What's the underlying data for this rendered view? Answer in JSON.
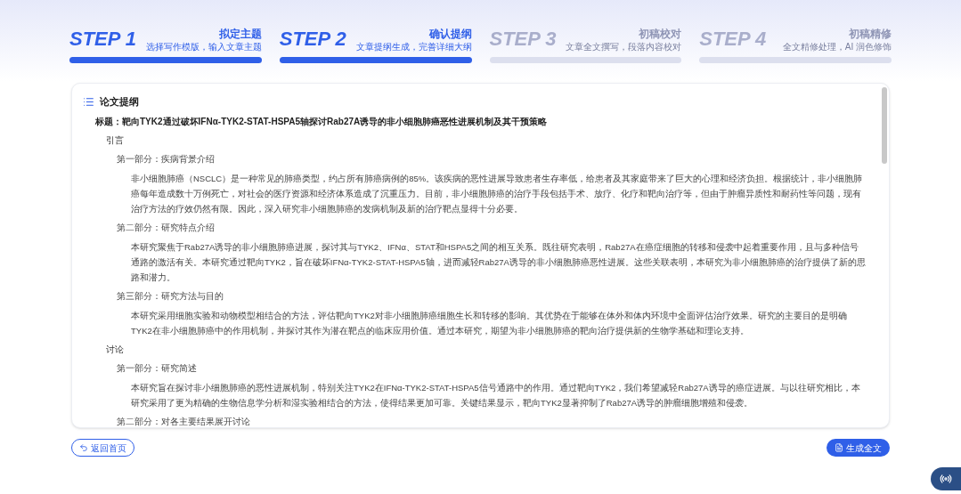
{
  "steps": [
    {
      "label": "STEP 1",
      "title": "拟定主题",
      "subtitle": "选择写作模版，输入文章主题",
      "active": true
    },
    {
      "label": "STEP 2",
      "title": "确认提纲",
      "subtitle": "文章提纲生成，完善详细大纲",
      "active": true
    },
    {
      "label": "STEP 3",
      "title": "初稿校对",
      "subtitle": "文章全文撰写，段落内容校对",
      "active": false
    },
    {
      "label": "STEP 4",
      "title": "初稿精修",
      "subtitle": "全文精修处理，AI 润色修饰",
      "active": false
    }
  ],
  "outline": {
    "heading": "论文提纲",
    "title": "标题：靶向TYK2通过破坏IFNα-TYK2-STAT-HSPA5轴探讨Rab27A诱导的非小细胞肺癌恶性进展机制及其干预策略",
    "sections": [
      {
        "name": "引言",
        "children": [
          {
            "name": "第一部分：疾病背景介绍",
            "text": "非小细胞肺癌（NSCLC）是一种常见的肺癌类型，约占所有肺癌病例的85%。该疾病的恶性进展导致患者生存率低，给患者及其家庭带来了巨大的心理和经济负担。根据统计，非小细胞肺癌每年造成数十万例死亡，对社会的医疗资源和经济体系造成了沉重压力。目前，非小细胞肺癌的治疗手段包括手术、放疗、化疗和靶向治疗等，但由于肿瘤异质性和耐药性等问题，现有治疗方法的疗效仍然有限。因此，深入研究非小细胞肺癌的发病机制及新的治疗靶点显得十分必要。"
          },
          {
            "name": "第二部分：研究特点介绍",
            "text": "本研究聚焦于Rab27A诱导的非小细胞肺癌进展，探讨其与TYK2、IFNα、STAT和HSPA5之间的相互关系。既往研究表明，Rab27A在癌症细胞的转移和侵袭中起着重要作用，且与多种信号通路的激活有关。本研究通过靶向TYK2，旨在破坏IFNα-TYK2-STAT-HSPA5轴，进而减轻Rab27A诱导的非小细胞肺癌恶性进展。这些关联表明，本研究为非小细胞肺癌的治疗提供了新的思路和潜力。"
          },
          {
            "name": "第三部分：研究方法与目的",
            "text": "本研究采用细胞实验和动物模型相结合的方法，评估靶向TYK2对非小细胞肺癌细胞生长和转移的影响。其优势在于能够在体外和体内环境中全面评估治疗效果。研究的主要目的是明确TYK2在非小细胞肺癌中的作用机制，并探讨其作为潜在靶点的临床应用价值。通过本研究，期望为非小细胞肺癌的靶向治疗提供新的生物学基础和理论支持。"
          }
        ]
      },
      {
        "name": "讨论",
        "children": [
          {
            "name": "第一部分：研究简述",
            "text": "本研究旨在探讨非小细胞肺癌的恶性进展机制，特别关注TYK2在IFNα-TYK2-STAT-HSPA5信号通路中的作用。通过靶向TYK2，我们希望减轻Rab27A诱导的癌症进展。与以往研究相比，本研究采用了更为精确的生物信息学分析和湿实验相结合的方法，使得结果更加可靠。关键结果显示，靶向TYK2显著抑制了Rab27A诱导的肿瘤细胞增殖和侵袭。"
          },
          {
            "name": "第二部分：对各主要结果展开讨论"
          }
        ]
      }
    ]
  },
  "buttons": {
    "back": "返回首页",
    "generate": "生成全文"
  }
}
